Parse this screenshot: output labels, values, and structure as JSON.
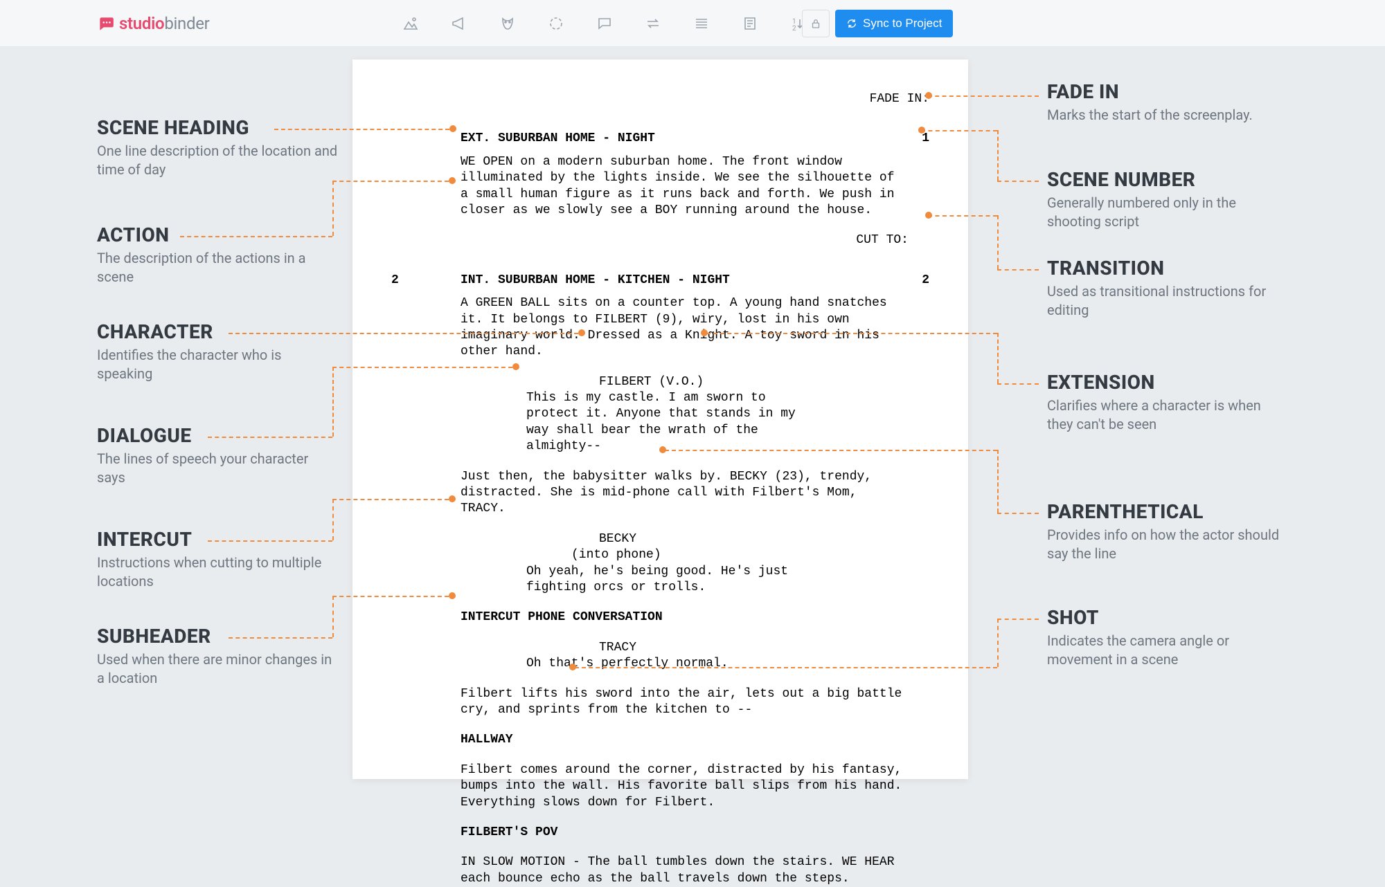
{
  "toolbar": {
    "brand_prefix": "studio",
    "brand_suffix": "binder",
    "sync_label": "Sync to Project"
  },
  "script": {
    "fade_in": "FADE IN:",
    "scene1_num": "1",
    "scene1_heading": "EXT. SUBURBAN HOME - NIGHT",
    "action1": "WE OPEN on a modern suburban home. The front window illuminated by the lights inside. We see the silhouette of a small human figure as it runs back and forth. We push in closer as we slowly see a BOY running around the house.",
    "transition1": "CUT TO:",
    "scene2_num": "2",
    "scene2_heading": "INT. SUBURBAN HOME - KITCHEN - NIGHT",
    "action2": "A GREEN BALL sits on a counter top. A young hand snatches it. It belongs to FILBERT (9), wiry, lost in his own imaginary world. Dressed as a Knight. A toy sword in his other hand.",
    "char1": "FILBERT (V.O.)",
    "dialogue1": "This is my castle. I am sworn to protect it. Anyone that stands in my way shall bear the wrath of the almighty--",
    "action3": "Just then, the babysitter walks by. BECKY (23), trendy, distracted. She is mid-phone call with Filbert's Mom, TRACY.",
    "char2": "BECKY",
    "paren1": "(into phone)",
    "dialogue2": "Oh yeah, he's being good. He's just fighting orcs or trolls.",
    "intercut": "INTERCUT PHONE CONVERSATION",
    "char3": "TRACY",
    "dialogue3": "Oh that's perfectly normal.",
    "action4": "Filbert lifts his sword into the air, lets out a big battle cry, and sprints from the kitchen to --",
    "subheader": "HALLWAY",
    "action5": "Filbert comes around the corner, distracted by his fantasy, bumps into the wall. His favorite ball slips from his hand. Everything slows down for Filbert.",
    "shot": "FILBERT'S POV",
    "action6": "IN SLOW MOTION - The ball tumbles down the stairs. WE HEAR each bounce echo as the ball travels down the steps."
  },
  "left_annos": {
    "scene_heading_t": "SCENE HEADING",
    "scene_heading_d": "One line description of the location and time of day",
    "action_t": "ACTION",
    "action_d": "The description of the actions in a scene",
    "character_t": "CHARACTER",
    "character_d": "Identifies the character who is speaking",
    "dialogue_t": "DIALOGUE",
    "dialogue_d": "The lines of speech your character says",
    "intercut_t": "INTERCUT",
    "intercut_d": "Instructions when cutting to multiple locations",
    "subheader_t": "SUBHEADER",
    "subheader_d": "Used when there are minor changes in a location"
  },
  "right_annos": {
    "fadein_t": "FADE IN",
    "fadein_d": "Marks the start of the screenplay.",
    "scenenum_t": "SCENE NUMBER",
    "scenenum_d": "Generally numbered only in the shooting script",
    "transition_t": "TRANSITION",
    "transition_d": "Used as transitional instructions for editing",
    "extension_t": "EXTENSION",
    "extension_d": "Clarifies where a character is when they can't be seen",
    "paren_t": "PARENTHETICAL",
    "paren_d": "Provides info on how the actor should say the line",
    "shot_t": "SHOT",
    "shot_d": "Indicates the camera angle or movement in a scene"
  }
}
